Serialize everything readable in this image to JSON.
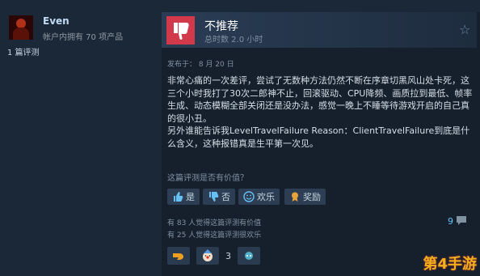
{
  "user": {
    "name": "Even",
    "products": "帐户内拥有 70 项产品",
    "reviews": "1 篇评测"
  },
  "review": {
    "verdict": "不推荐",
    "hours": "总时数 2.0 小时",
    "posted": "发布于： 8 月 20 日",
    "paragraphs": [
      "非常心痛的一次差评，尝试了无数种方法仍然不断在序章切黑风山处卡死，这三个小时我打了30次二郎神不止，回滚驱动、CPU降频、画质拉到最低、帧率生成、动态模糊全部关闭还是没办法，感觉一晚上不睡等待游戏开启的自己真的很小丑。",
      "另外谁能告诉我LevelTravelFailure Reason：ClientTravelFailure到底是什么含义，这种报错真是生平第一次见。"
    ]
  },
  "helpful": {
    "question": "这篇评测是否有价值？",
    "yes": "是",
    "no": "否",
    "funny": "欢乐",
    "award": "奖励",
    "helpful_count": "有 83 人觉得这篇评测有价值",
    "funny_count": "有 25 人觉得这篇评测很欢乐",
    "comments": "9"
  },
  "awards": {
    "count": "3"
  },
  "watermark": "第4手游",
  "colors": {
    "thumb_bg": "#d2394a",
    "link": "#66c0f4",
    "panel": "#16202d"
  }
}
